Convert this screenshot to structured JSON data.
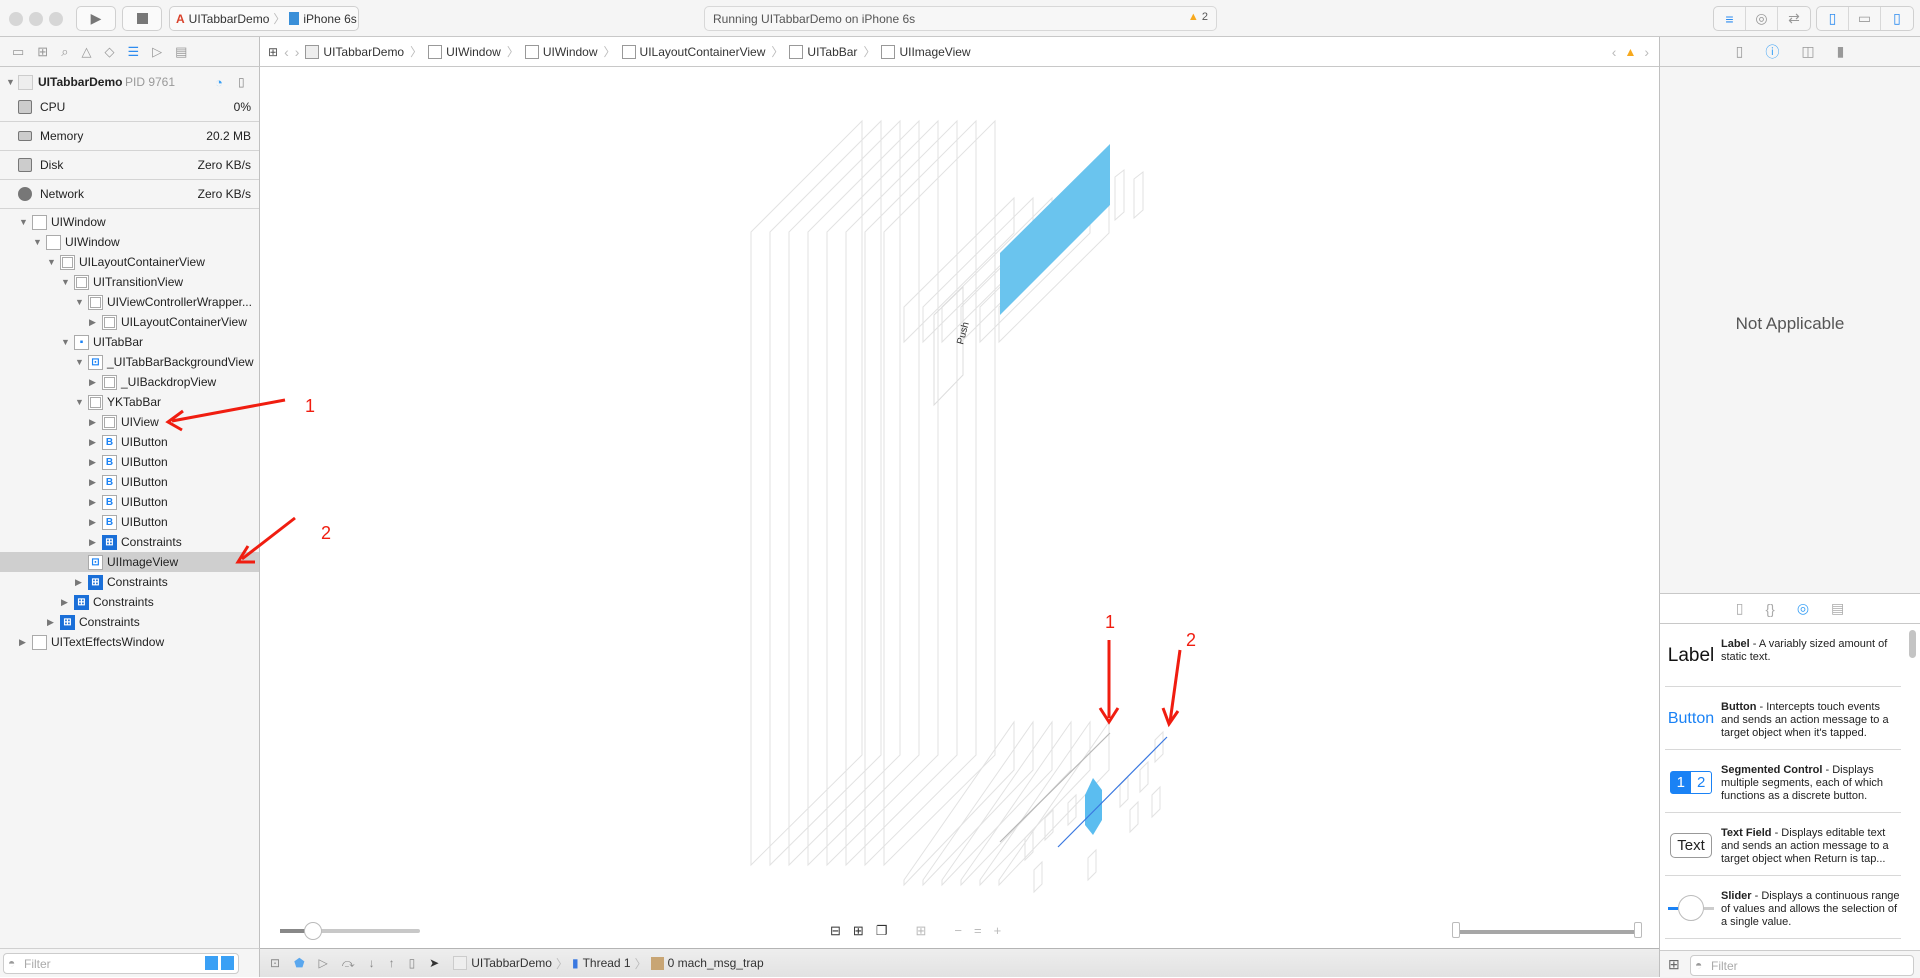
{
  "toolbar": {
    "scheme": "UITabbarDemo",
    "device": "iPhone 6s",
    "activity": "Running UITabbarDemo on iPhone 6s",
    "warnings": "2",
    "warning_color": "#f7a91d"
  },
  "navigator_icons": [
    "folder-icon",
    "hierarchy-icon",
    "search-icon",
    "warning-icon",
    "test-icon",
    "debug-icon",
    "breakpoint-icon",
    "report-icon"
  ],
  "jumpbar": {
    "crumbs": [
      "UITabbarDemo",
      "UIWindow",
      "UIWindow",
      "UILayoutContainerView",
      "UITabBar",
      "UIImageView"
    ]
  },
  "process": {
    "name": "UITabbarDemo",
    "pid": "PID 9761"
  },
  "resources": [
    {
      "label": "CPU",
      "value": "0%"
    },
    {
      "label": "Memory",
      "value": "20.2 MB"
    },
    {
      "label": "Disk",
      "value": "Zero KB/s"
    },
    {
      "label": "Network",
      "value": "Zero KB/s"
    }
  ],
  "tree": [
    {
      "label": "UIWindow",
      "depth": 0,
      "state": "open",
      "icon": "window"
    },
    {
      "label": "UIWindow",
      "depth": 1,
      "state": "open",
      "icon": "window"
    },
    {
      "label": "UILayoutContainerView",
      "depth": 2,
      "state": "open",
      "icon": "view"
    },
    {
      "label": "UITransitionView",
      "depth": 3,
      "state": "open",
      "icon": "view"
    },
    {
      "label": "UIViewControllerWrapper...",
      "depth": 4,
      "state": "open",
      "icon": "view"
    },
    {
      "label": "UILayoutContainerView",
      "depth": 5,
      "state": "closed",
      "icon": "view"
    },
    {
      "label": "UITabBar",
      "depth": 3,
      "state": "open",
      "icon": "tabbar"
    },
    {
      "label": "_UITabBarBackgroundView",
      "depth": 4,
      "state": "open",
      "icon": "image"
    },
    {
      "label": "_UIBackdropView",
      "depth": 5,
      "state": "closed",
      "icon": "view"
    },
    {
      "label": "YKTabBar",
      "depth": 4,
      "state": "open",
      "icon": "view"
    },
    {
      "label": "UIView",
      "depth": 5,
      "state": "closed",
      "icon": "view"
    },
    {
      "label": "UIButton",
      "depth": 5,
      "state": "closed",
      "icon": "button"
    },
    {
      "label": "UIButton",
      "depth": 5,
      "state": "closed",
      "icon": "button"
    },
    {
      "label": "UIButton",
      "depth": 5,
      "state": "closed",
      "icon": "button"
    },
    {
      "label": "UIButton",
      "depth": 5,
      "state": "closed",
      "icon": "button"
    },
    {
      "label": "UIButton",
      "depth": 5,
      "state": "closed",
      "icon": "button"
    },
    {
      "label": "Constraints",
      "depth": 5,
      "state": "closed",
      "icon": "constraints"
    },
    {
      "label": "UIImageView",
      "depth": 4,
      "state": "none",
      "icon": "image",
      "selected": true
    },
    {
      "label": "Constraints",
      "depth": 4,
      "state": "closed",
      "icon": "constraints"
    },
    {
      "label": "Constraints",
      "depth": 3,
      "state": "closed",
      "icon": "constraints"
    },
    {
      "label": "Constraints",
      "depth": 2,
      "state": "closed",
      "icon": "constraints"
    },
    {
      "label": "UITextEffectsWindow",
      "depth": 0,
      "state": "closed",
      "icon": "window"
    }
  ],
  "annotations": {
    "one": "1",
    "two": "2",
    "color": "#f01d10"
  },
  "canvas": {
    "push_label": "Push",
    "highlight_color": "#6ac4ee",
    "selected_line_color": "#3a78e0"
  },
  "filter_placeholder": "Filter",
  "debugbar": {
    "process": "UITabbarDemo",
    "thread": "Thread 1",
    "frame": "0 mach_msg_trap"
  },
  "inspector": {
    "empty": "Not Applicable"
  },
  "library": [
    {
      "preview": "Label",
      "name": "Label",
      "desc": " - A variably sized amount of static text."
    },
    {
      "preview": "Button",
      "name": "Button",
      "desc": " - Intercepts touch events and sends an action message to a target object when it's tapped."
    },
    {
      "preview": "12",
      "name": "Segmented Control",
      "desc": " - Displays multiple segments, each of which functions as a discrete button."
    },
    {
      "preview": "Text",
      "name": "Text Field",
      "desc": " - Displays editable text and sends an action message to a target object when Return is tap..."
    },
    {
      "preview": "",
      "name": "Slider",
      "desc": " - Displays a continuous range of values and allows the selection of a single value."
    }
  ]
}
